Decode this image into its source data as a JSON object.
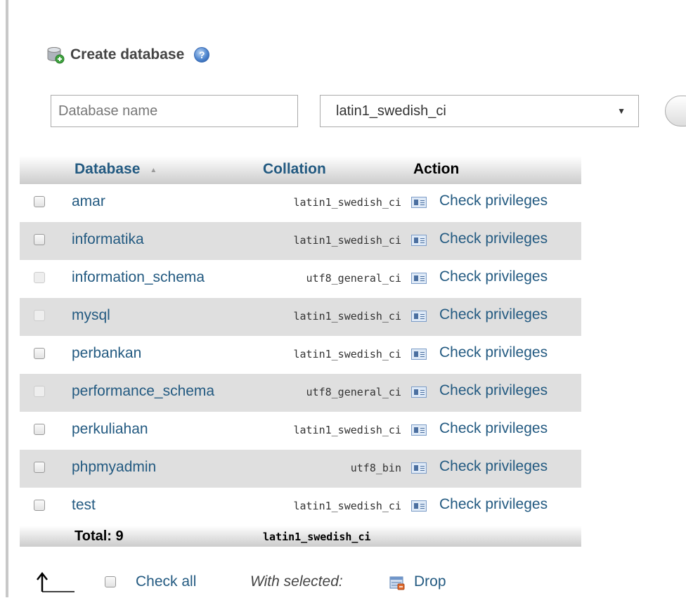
{
  "header": {
    "title": "Create database",
    "help_glyph": "?"
  },
  "create_form": {
    "name_placeholder": "Database name",
    "collation_selected": "latin1_swedish_ci"
  },
  "table": {
    "columns": {
      "database": "Database",
      "collation": "Collation",
      "action": "Action"
    },
    "sort_indicator": "▲",
    "rows": [
      {
        "name": "amar",
        "collation": "latin1_swedish_ci",
        "action": "Check privileges",
        "checkbox_enabled": true
      },
      {
        "name": "informatika",
        "collation": "latin1_swedish_ci",
        "action": "Check privileges",
        "checkbox_enabled": true
      },
      {
        "name": "information_schema",
        "collation": "utf8_general_ci",
        "action": "Check privileges",
        "checkbox_enabled": false
      },
      {
        "name": "mysql",
        "collation": "latin1_swedish_ci",
        "action": "Check privileges",
        "checkbox_enabled": false
      },
      {
        "name": "perbankan",
        "collation": "latin1_swedish_ci",
        "action": "Check privileges",
        "checkbox_enabled": true
      },
      {
        "name": "performance_schema",
        "collation": "utf8_general_ci",
        "action": "Check privileges",
        "checkbox_enabled": false
      },
      {
        "name": "perkuliahan",
        "collation": "latin1_swedish_ci",
        "action": "Check privileges",
        "checkbox_enabled": true
      },
      {
        "name": "phpmyadmin",
        "collation": "utf8_bin",
        "action": "Check privileges",
        "checkbox_enabled": true
      },
      {
        "name": "test",
        "collation": "latin1_swedish_ci",
        "action": "Check privileges",
        "checkbox_enabled": true
      }
    ],
    "total_label": "Total: 9",
    "total_collation": "latin1_swedish_ci"
  },
  "bottom": {
    "check_all_label": "Check all",
    "with_selected_label": "With selected:",
    "drop_label": "Drop"
  },
  "icons": {
    "database": "database-add-icon",
    "help": "help-icon",
    "privileges": "privileges-icon",
    "up_arrow": "arrow-up-icon",
    "drop": "drop-icon"
  },
  "colors": {
    "link": "#235a81",
    "row_alt": "#dfdfdf"
  }
}
